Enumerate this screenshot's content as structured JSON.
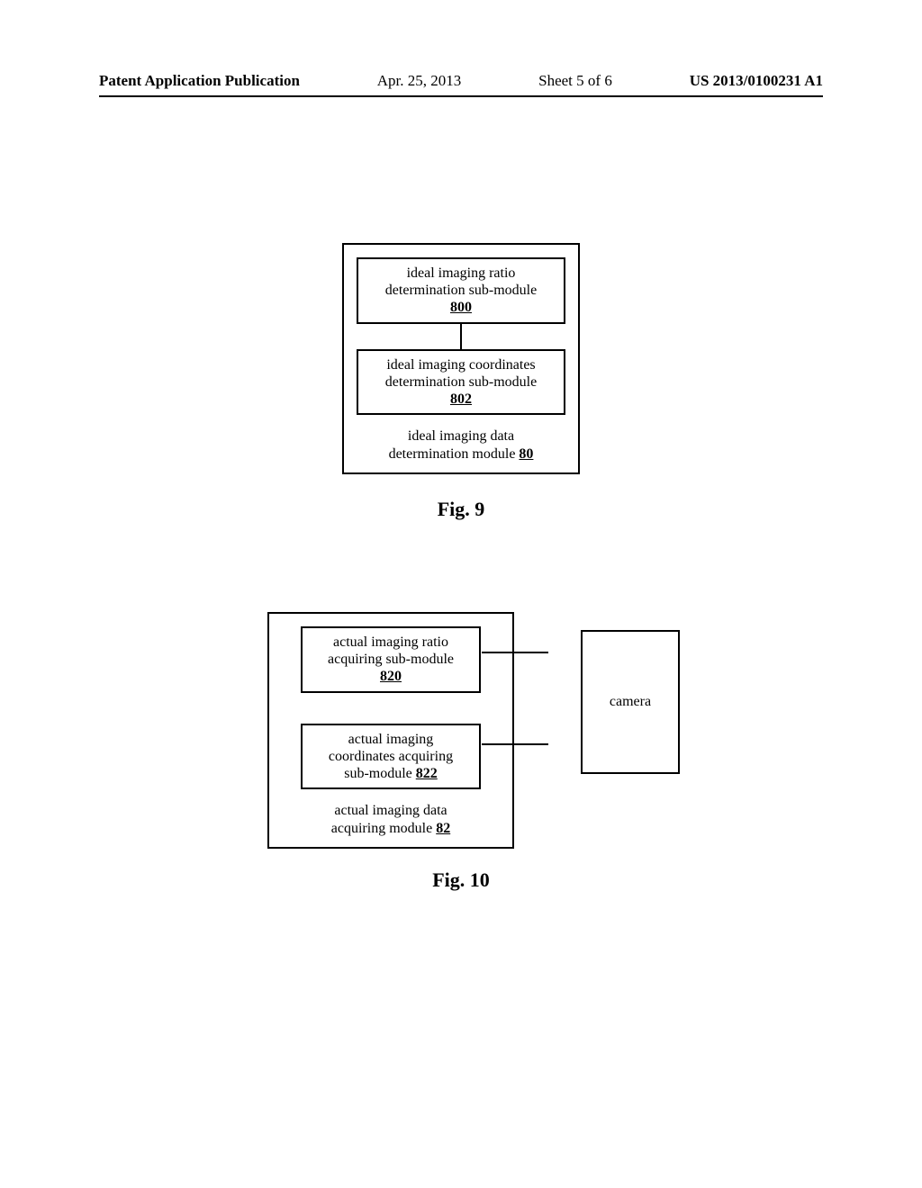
{
  "header": {
    "publication": "Patent Application Publication",
    "date": "Apr. 25, 2013",
    "sheet": "Sheet 5 of 6",
    "docnum": "US 2013/0100231 A1"
  },
  "fig9": {
    "sub1_line1": "ideal imaging ratio",
    "sub1_line2": "determination sub-module",
    "sub1_ref": "800",
    "sub2_line1": "ideal imaging coordinates",
    "sub2_line2": "determination sub-module",
    "sub2_ref": "802",
    "module_line1": "ideal imaging data",
    "module_line2_prefix": "determination module ",
    "module_ref": "80",
    "caption": "Fig. 9"
  },
  "fig10": {
    "sub1_line1": "actual imaging ratio",
    "sub1_line2": "acquiring sub-module",
    "sub1_ref": "820",
    "sub2_line1": "actual imaging",
    "sub2_line2": "coordinates acquiring",
    "sub2_line3_prefix": "sub-module ",
    "sub2_ref": "822",
    "module_line1": "actual imaging data",
    "module_line2_prefix": "acquiring module ",
    "module_ref": "82",
    "camera_label": "camera",
    "caption": "Fig. 10"
  }
}
